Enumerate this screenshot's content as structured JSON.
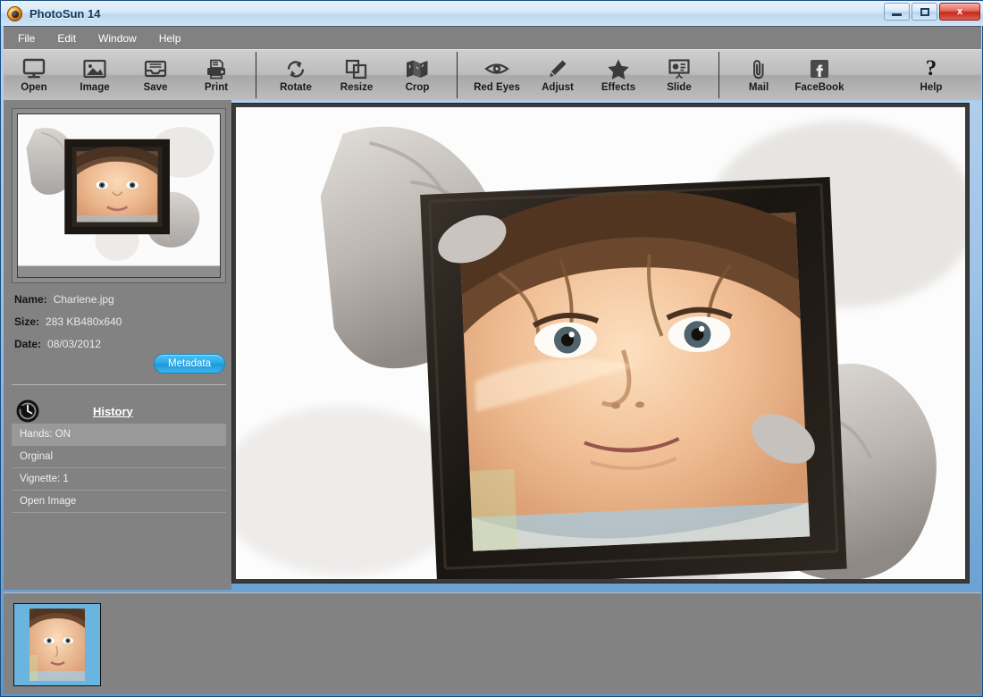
{
  "window": {
    "title": "PhotoSun 14",
    "app_icon": "camera-lens-icon",
    "controls": {
      "minimize": "–",
      "maximize": "□",
      "close": "x"
    }
  },
  "menubar": {
    "items": [
      {
        "label": "File"
      },
      {
        "label": "Edit"
      },
      {
        "label": "Window"
      },
      {
        "label": "Help"
      }
    ]
  },
  "toolbar": {
    "groups": [
      {
        "items": [
          {
            "label": "Open",
            "icon": "monitor-icon"
          },
          {
            "label": "Image",
            "icon": "picture-icon"
          },
          {
            "label": "Save",
            "icon": "inbox-tray-icon"
          },
          {
            "label": "Print",
            "icon": "printer-icon"
          }
        ]
      },
      {
        "items": [
          {
            "label": "Rotate",
            "icon": "rotate-arrows-icon"
          },
          {
            "label": "Resize",
            "icon": "overlapping-squares-icon"
          },
          {
            "label": "Crop",
            "icon": "folded-map-icon"
          }
        ]
      },
      {
        "items": [
          {
            "label": "Red Eyes",
            "icon": "eye-icon"
          },
          {
            "label": "Adjust",
            "icon": "pencil-icon"
          },
          {
            "label": "Effects",
            "icon": "star-icon"
          },
          {
            "label": "Slide",
            "icon": "presentation-board-icon"
          }
        ]
      },
      {
        "items": [
          {
            "label": "Mail",
            "icon": "paperclip-icon"
          },
          {
            "label": "FaceBook",
            "icon": "facebook-f-icon"
          }
        ]
      },
      {
        "items": [
          {
            "label": "Help",
            "icon": "question-mark-icon"
          }
        ]
      }
    ]
  },
  "sidebar": {
    "preview_alt": "hands-holding-frame-photo",
    "info": {
      "name_key": "Name:",
      "name_value": "Charlene.jpg",
      "size_key": "Size:",
      "size_value": "283 KB",
      "dimensions_value": "480x640",
      "date_key": "Date:",
      "date_value": "08/03/2012"
    },
    "metadata_button": "Metadata",
    "history": {
      "icon": "clock-rewind-icon",
      "title": "History",
      "items": [
        {
          "label": "Hands: ON",
          "selected": true
        },
        {
          "label": "Orginal",
          "selected": false
        },
        {
          "label": "Vignette: 1",
          "selected": false
        },
        {
          "label": "Open Image",
          "selected": false
        }
      ]
    }
  },
  "canvas": {
    "image_alt": "girl-portrait-inside-wooden-frame-held-by-hands"
  },
  "filmstrip": {
    "thumbnails": [
      {
        "alt": "girl-portrait-thumbnail",
        "selected": true
      }
    ]
  },
  "colors": {
    "accent_blue": "#27a6e6",
    "panel_gray": "#828282",
    "toolbar_gray": "#bcbcbc",
    "menubar_gray": "#818181",
    "selected_row": "#999999",
    "thumb_select_blue": "#6ab4e0",
    "close_red": "#c3291c"
  }
}
